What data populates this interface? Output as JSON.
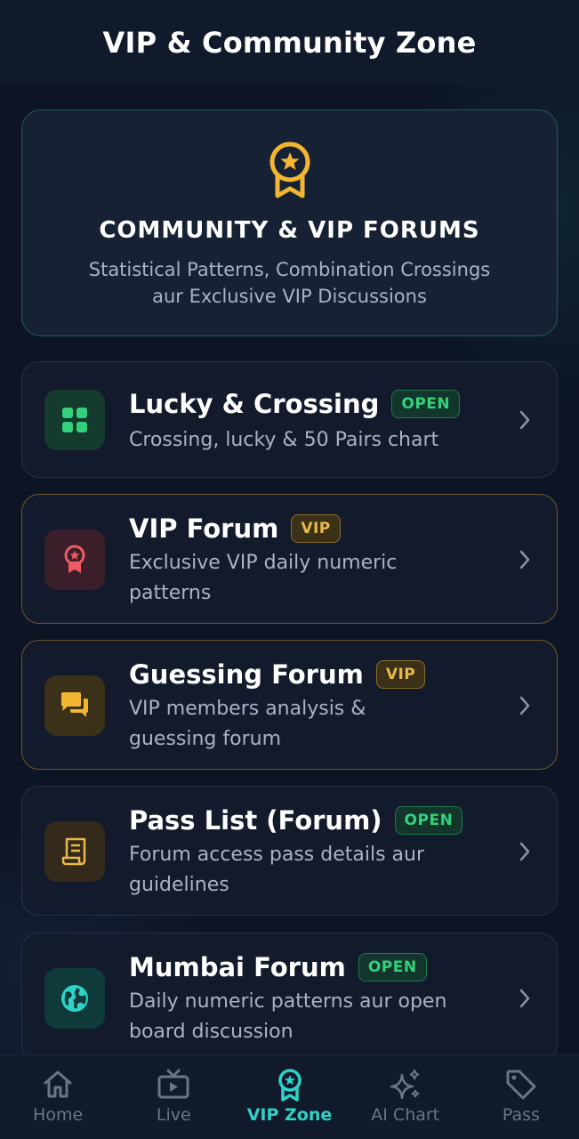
{
  "header": {
    "title": "VIP & Community Zone"
  },
  "hero": {
    "icon": "medal-icon",
    "title": "COMMUNITY & VIP FORUMS",
    "subtitle_line1": "Statistical Patterns, Combination Crossings",
    "subtitle_line2": "aur Exclusive VIP Discussions"
  },
  "forums": [
    {
      "title": "Lucky & Crossing",
      "badge": "OPEN",
      "desc_line1": "Crossing, lucky & 50 Pairs chart",
      "desc_line2": "",
      "icon": "grid-icon"
    },
    {
      "title": "VIP Forum",
      "badge": "VIP",
      "desc_line1": "Exclusive VIP daily numeric",
      "desc_line2": "patterns",
      "icon": "award-icon"
    },
    {
      "title": "Guessing Forum",
      "badge": "VIP",
      "desc_line1": "VIP members analysis &",
      "desc_line2": "guessing forum",
      "icon": "chat-icon"
    },
    {
      "title": "Pass List (Forum)",
      "badge": "OPEN",
      "desc_line1": "Forum access pass details aur",
      "desc_line2": "guidelines",
      "icon": "receipt-icon"
    },
    {
      "title": "Mumbai Forum",
      "badge": "OPEN",
      "desc_line1": "Daily numeric patterns aur open",
      "desc_line2": "board discussion",
      "icon": "globe-icon"
    }
  ],
  "tabs": [
    {
      "label": "Home",
      "icon": "home-icon",
      "active": false
    },
    {
      "label": "Live",
      "icon": "tv-icon",
      "active": false
    },
    {
      "label": "VIP Zone",
      "icon": "medal-icon",
      "active": true
    },
    {
      "label": "AI Chart",
      "icon": "sparkles-icon",
      "active": false
    },
    {
      "label": "Pass",
      "icon": "tag-icon",
      "active": false
    }
  ],
  "colors": {
    "accent": "#2ed3c6",
    "gold": "#f2b632",
    "open_green": "#33d17a",
    "background": "#0d1424"
  }
}
